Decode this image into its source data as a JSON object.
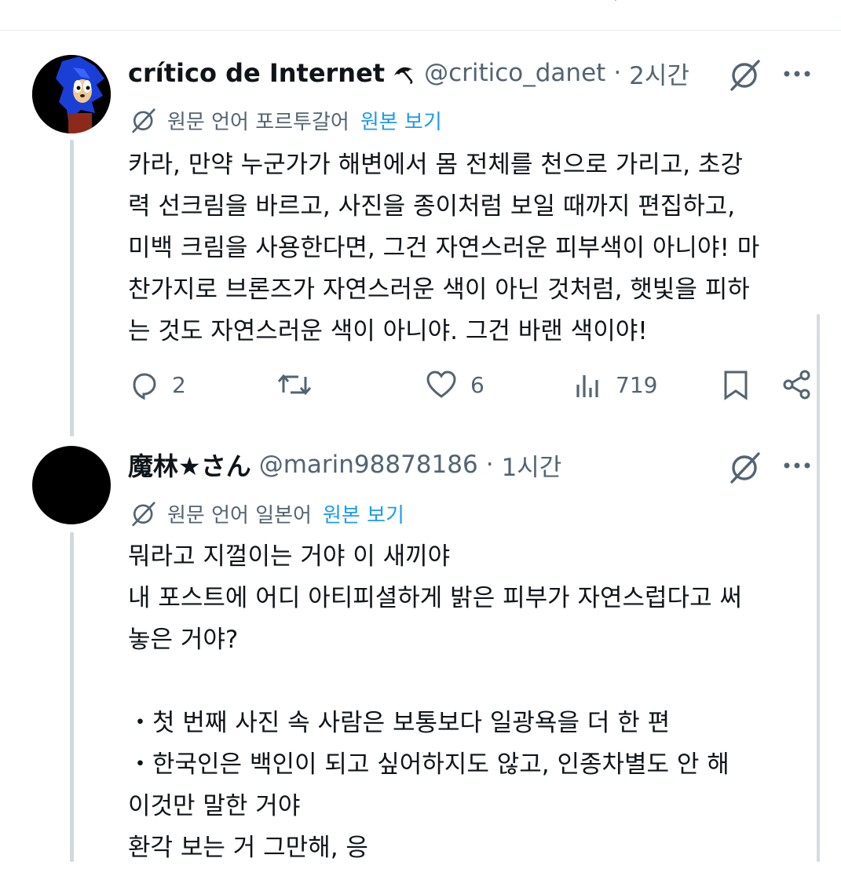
{
  "tweets": [
    {
      "display_name": "crítico de Internet",
      "name_emoji": "umbrella-emoji",
      "handle": "@critico_danet",
      "separator": "·",
      "time": "2시간",
      "translate_label": "원문 언어 포르투갈어",
      "translate_link": "원본 보기",
      "body_lines": [
        "카라, 만약 누군가가 해변에서 몸 전체를 천으로 가리고, 초강",
        "력 선크림을 바르고, 사진을 종이처럼 보일 때까지 편집하고,",
        "미백 크림을 사용한다면, 그건 자연스러운 피부색이 아니야! 마",
        "찬가지로 브론즈가 자연스러운 색이 아닌 것처럼, 햇빛을 피하",
        "는 것도 자연스러운 색이 아니야. 그건 바랜 색이야!"
      ],
      "actions": {
        "replies": "2",
        "retweets": "",
        "likes": "6",
        "views": "719"
      }
    },
    {
      "display_name": "魔林★さん",
      "handle": "@marin98878186",
      "separator": "·",
      "time": "1시간",
      "translate_label": "원문 언어 일본어",
      "translate_link": "원본 보기",
      "body_lines": [
        "뭐라고 지껄이는 거야 이 새끼야",
        "내 포스트에 어디 아티피셜하게 밝은 피부가 자연스럽다고 써",
        "놓은 거야?",
        "",
        "・첫 번째 사진 속 사람은 보통보다 일광욕을 더 한 편",
        "・한국인은 백인이 되고 싶어하지도 않고, 인종차별도 안 해",
        "이것만 말한 거야",
        "환각 보는 거 그만해, 응"
      ]
    }
  ],
  "icons": {
    "translate": "grok-translate-icon",
    "more": "more-icon",
    "reply": "reply-icon",
    "retweet": "retweet-icon",
    "like": "heart-icon",
    "views": "views-icon",
    "bookmark": "bookmark-icon",
    "share": "share-icon"
  },
  "colors": {
    "link": "#1d9bf0",
    "secondary_text": "#536471",
    "thread_line": "#cfd9de"
  }
}
